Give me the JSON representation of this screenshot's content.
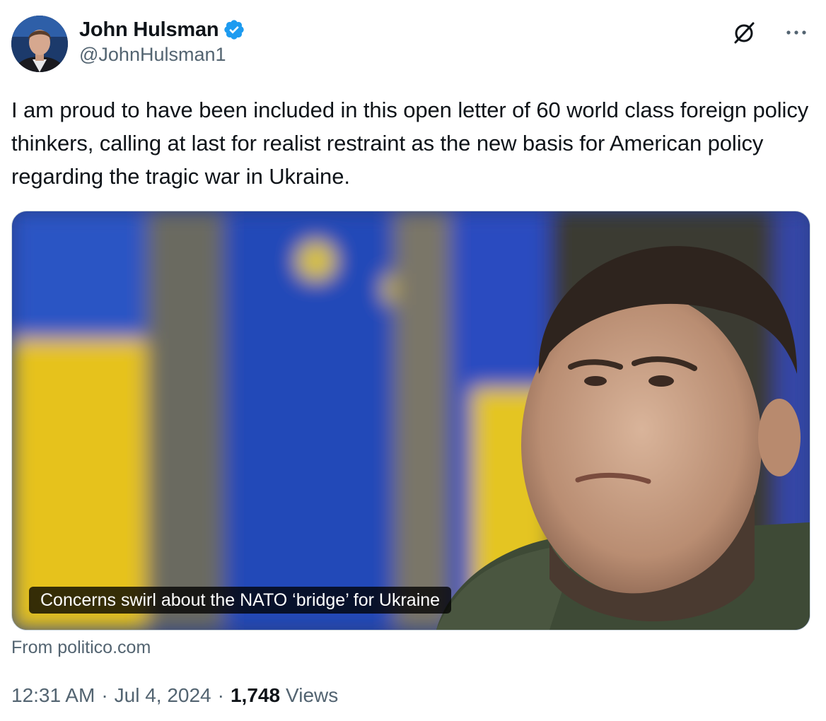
{
  "author": {
    "display_name": "John Hulsman",
    "handle": "@JohnHulsman1",
    "verified": true,
    "verified_color": "#1d9bf0"
  },
  "actions": {
    "grok_icon": "grok-icon",
    "more_icon": "more-icon"
  },
  "tweet": {
    "text": "I am proud to have been included in this open letter of 60 world class foreign policy thinkers, calling at last for realist restraint as the new basis for American policy regarding the tragic war in Ukraine."
  },
  "link_card": {
    "caption": "Concerns swirl about the NATO ‘bridge’ for Ukraine",
    "source": "From politico.com"
  },
  "meta": {
    "time": "12:31 AM",
    "separator": "·",
    "date": "Jul 4, 2024",
    "views_count": "1,748",
    "views_label": "Views"
  },
  "colors": {
    "text_primary": "#0f1419",
    "text_secondary": "#536471",
    "border": "#cfd9de"
  }
}
